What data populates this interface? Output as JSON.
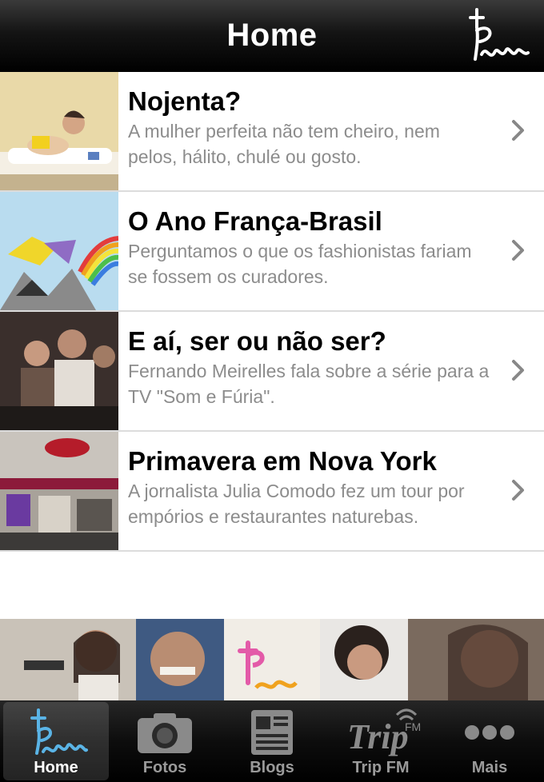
{
  "navbar": {
    "title": "Home",
    "logo_icon": "tpm-logo-icon"
  },
  "articles": [
    {
      "title": "Nojenta?",
      "description": "A mulher perfeita não tem cheiro, nem pelos, hálito, chulé ou gosto."
    },
    {
      "title": "O Ano França-Brasil",
      "description": "Perguntamos o que os fashionistas fariam se fossem os curadores."
    },
    {
      "title": "E aí, ser ou não ser?",
      "description": "Fernando Meirelles fala sobre a série para a TV \"Som e Fúria\"."
    },
    {
      "title": "Primavera em Nova York",
      "description": "A jornalista Julia Comodo fez um tour por empórios e restaurantes naturebas."
    }
  ],
  "tabs": [
    {
      "label": "Home",
      "icon": "tpm-logo-icon",
      "active": true
    },
    {
      "label": "Fotos",
      "icon": "camera-icon",
      "active": false
    },
    {
      "label": "Blogs",
      "icon": "newspaper-icon",
      "active": false
    },
    {
      "label": "Trip FM",
      "icon": "trip-fm-icon",
      "active": false
    },
    {
      "label": "Mais",
      "icon": "more-dots-icon",
      "active": false
    }
  ],
  "colors": {
    "accent": "#5ab4e6",
    "description_text": "#8c8c8c",
    "separator": "#dcdcdc"
  }
}
